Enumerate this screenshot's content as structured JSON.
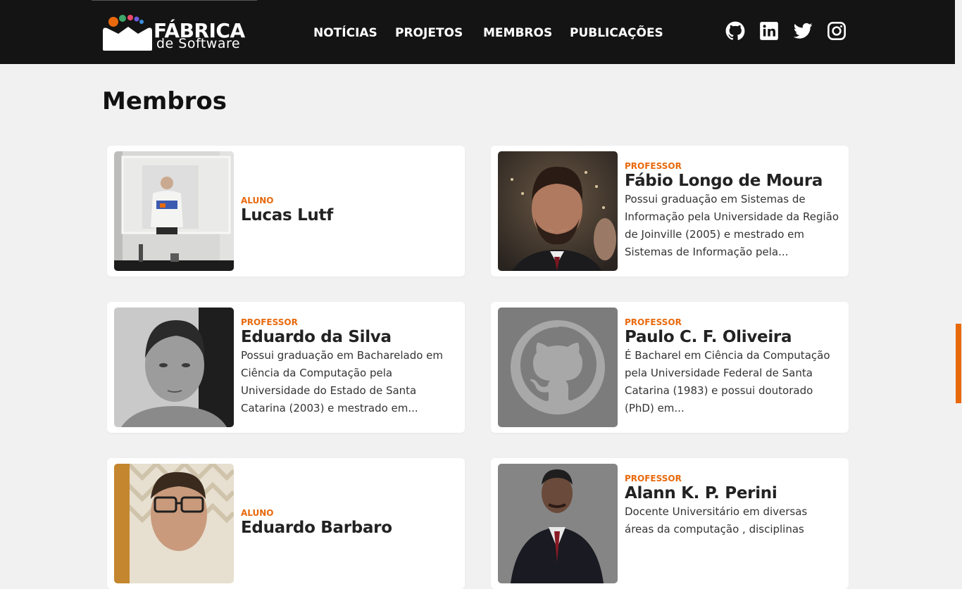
{
  "header": {
    "logo": {
      "title": "FÁBRICA",
      "subtitle": "de Software"
    },
    "nav": [
      {
        "label": "NOTÍCIAS"
      },
      {
        "label": "PROJETOS"
      },
      {
        "label": "MEMBROS"
      },
      {
        "label": "PUBLICAÇÕES"
      }
    ],
    "social": [
      {
        "icon": "github-icon"
      },
      {
        "icon": "linkedin-icon"
      },
      {
        "icon": "twitter-icon"
      },
      {
        "icon": "instagram-icon"
      }
    ]
  },
  "page": {
    "title": "Membros"
  },
  "members": [
    {
      "role": "ALUNO",
      "name": "Lucas Lutf",
      "bio": ""
    },
    {
      "role": "PROFESSOR",
      "name": "Fábio Longo de Moura",
      "bio": "Possui graduação em Sistemas de Informação pela Universidade da Região de Joinville (2005) e mestrado em Sistemas de Informação pela..."
    },
    {
      "role": "PROFESSOR",
      "name": "Eduardo da Silva",
      "bio": "Possui graduação em Bacharelado em Ciência da Computação pela Universidade do Estado de Santa Catarina (2003) e mestrado em..."
    },
    {
      "role": "PROFESSOR",
      "name": "Paulo C. F. Oliveira",
      "bio": "É Bacharel em Ciência da Computação pela Universidade Federal de Santa Catarina (1983) e possui doutorado (PhD) em..."
    },
    {
      "role": "ALUNO",
      "name": "Eduardo Barbaro",
      "bio": ""
    },
    {
      "role": "PROFESSOR",
      "name": "Alann K. P. Perini",
      "bio": "Docente Universitário em diversas áreas da computação , disciplinas"
    }
  ],
  "colors": {
    "header_bg": "#141414",
    "accent": "#e8690c",
    "page_bg": "#f1f1f1"
  }
}
